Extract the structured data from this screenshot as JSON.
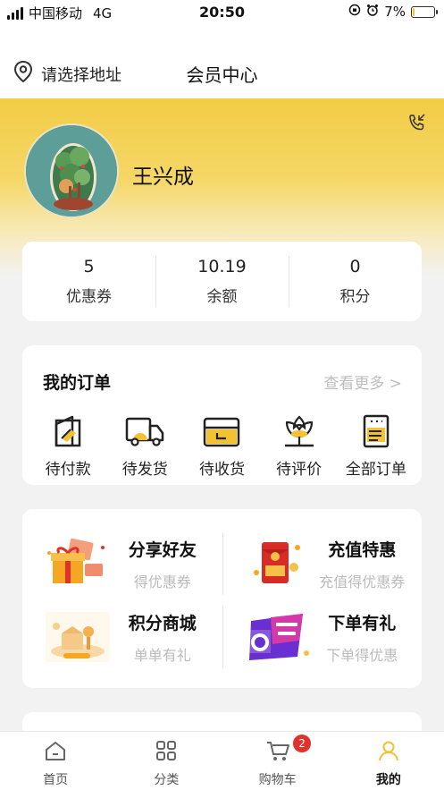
{
  "status_bar": {
    "carrier": "中国移动",
    "network": "4G",
    "time": "20:50",
    "battery_percent": "7%",
    "battery_level": 0.07
  },
  "header": {
    "address_label": "请选择地址",
    "title": "会员中心"
  },
  "profile": {
    "name": "王兴成"
  },
  "stats": [
    {
      "value": "5",
      "label": "优惠券"
    },
    {
      "value": "10.19",
      "label": "余额"
    },
    {
      "value": "0",
      "label": "积分"
    }
  ],
  "orders": {
    "title": "我的订单",
    "more": "查看更多 >",
    "items": [
      {
        "label": "待付款",
        "icon": "wallet-icon"
      },
      {
        "label": "待发货",
        "icon": "truck-icon"
      },
      {
        "label": "待收货",
        "icon": "box-icon"
      },
      {
        "label": "待评价",
        "icon": "flower-icon"
      },
      {
        "label": "全部订单",
        "icon": "list-icon"
      }
    ]
  },
  "promos": [
    {
      "title": "分享好友",
      "subtitle": "得优惠券",
      "icon": "gift-box-icon"
    },
    {
      "title": "充值特惠",
      "subtitle": "充值得优惠券",
      "icon": "red-envelope-icon"
    },
    {
      "title": "积分商城",
      "subtitle": "单单有礼",
      "icon": "points-mall-icon"
    },
    {
      "title": "下单有礼",
      "subtitle": "下单得优惠",
      "icon": "coupon-banner-icon"
    }
  ],
  "tabbar": {
    "items": [
      {
        "label": "首页",
        "icon": "home-icon"
      },
      {
        "label": "分类",
        "icon": "grid-icon"
      },
      {
        "label": "购物车",
        "icon": "cart-icon",
        "badge": "2"
      },
      {
        "label": "我的",
        "icon": "user-icon",
        "active": true
      }
    ]
  },
  "colors": {
    "accent": "#f2c233",
    "badge": "#e0322b",
    "muted_text": "#bbbbbb"
  }
}
